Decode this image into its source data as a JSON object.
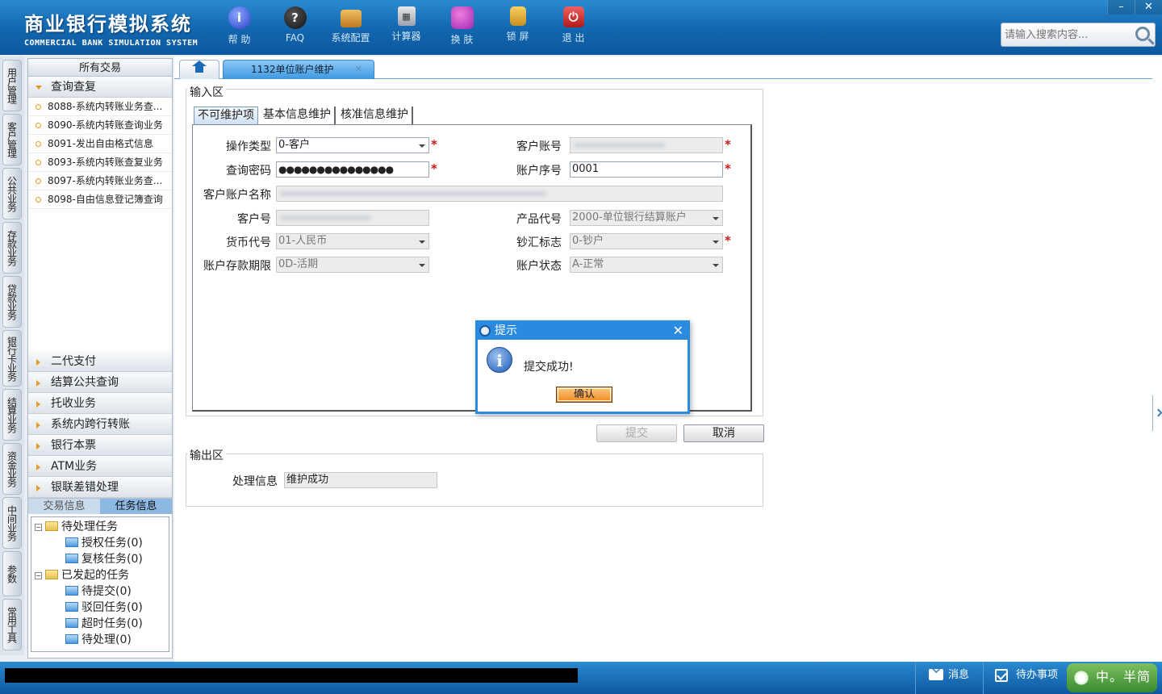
{
  "header": {
    "title_cn": "商业银行模拟系统",
    "title_en": "COMMERCIAL BANK SIMULATION SYSTEM",
    "toolbar": [
      {
        "label": "帮 助",
        "icon": "help-icon"
      },
      {
        "label": "FAQ",
        "icon": "faq-icon"
      },
      {
        "label": "系统配置",
        "icon": "config-icon"
      },
      {
        "label": "计算器",
        "icon": "calculator-icon"
      },
      {
        "label": "换 肤",
        "icon": "skin-icon"
      },
      {
        "label": "锁 屏",
        "icon": "lock-icon"
      },
      {
        "label": "退 出",
        "icon": "exit-icon"
      }
    ],
    "window_controls": {
      "minimize": "–",
      "close": "✕"
    },
    "search": {
      "placeholder": "请输入搜索内容..."
    }
  },
  "vtabs": [
    "用户管理",
    "客户管理",
    "公共业务",
    "存款业务",
    "贷款业务",
    "银行卡业务",
    "结算业务",
    "资金业务",
    "中间业务",
    "参数",
    "常用工具"
  ],
  "leftpanel": {
    "header": "所有交易",
    "open_category": "查询查复",
    "transactions": [
      "8088-系统内转账业务查...",
      "8090-系统内转账查询业务",
      "8091-发出自由格式信息",
      "8093-系统内转账查复业务",
      "8097-系统内转账业务查...",
      "8098-自由信息登记簿查询"
    ],
    "categories": [
      "二代支付",
      "结算公共查询",
      "托收业务",
      "系统内跨行转账",
      "银行本票",
      "ATM业务",
      "银联差错处理"
    ],
    "bottom_tabs": [
      "交易信息",
      "任务信息"
    ],
    "tree": {
      "pending": "待处理任务",
      "pending_children": [
        "授权任务(0)",
        "复核任务(0)"
      ],
      "started": "已发起的任务",
      "started_children": [
        "待提交(0)",
        "驳回任务(0)",
        "超时任务(0)",
        "待处理(0)"
      ]
    }
  },
  "main": {
    "tab_label": "1132单位账户维护",
    "tab_close": "✕",
    "input_legend": "输入区",
    "subtabs": [
      "不可维护项",
      "基本信息维护",
      "核准信息维护"
    ],
    "fields": {
      "op_type_label": "操作类型",
      "op_type_value": "0-客户",
      "cust_account_label": "客户账号",
      "cust_account_value": "",
      "query_pwd_label": "查询密码",
      "query_pwd_value": "●●●●●●●●●●●●●●●",
      "account_seq_label": "账户序号",
      "account_seq_value": "0001",
      "account_name_label": "客户账户名称",
      "account_name_value": "",
      "cust_no_label": "客户号",
      "cust_no_value": "",
      "product_code_label": "产品代号",
      "product_code_value": "2000-单位银行结算账户",
      "currency_label": "货币代号",
      "currency_value": "01-人民币",
      "cash_flag_label": "钞汇标志",
      "cash_flag_value": "0-钞户",
      "term_label": "账户存款期限",
      "term_value": "0D-活期",
      "status_label": "账户状态",
      "status_value": "A-正常"
    },
    "required_mark": "*",
    "submit_label": "提交",
    "cancel_label": "取消",
    "output_legend": "输出区",
    "result_label": "处理信息",
    "result_value": "维护成功"
  },
  "dialog": {
    "title": "提示",
    "close": "✕",
    "icon_glyph": "i",
    "message": "提交成功!",
    "ok_label": "确认"
  },
  "statusbar": {
    "messages_label": "消息",
    "todo_label": "待办事项",
    "ime_label": "中。半简"
  }
}
